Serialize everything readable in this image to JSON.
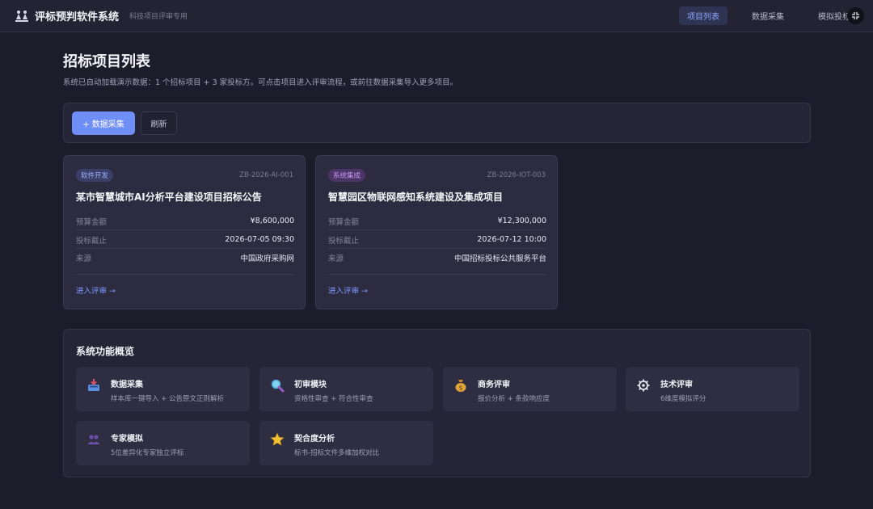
{
  "app": {
    "title": "评标预判软件系统",
    "subtitle": "科技项目评审专用"
  },
  "nav": {
    "items": [
      {
        "label": "项目列表",
        "active": true
      },
      {
        "label": "数据采集",
        "active": false
      },
      {
        "label": "模拟投标",
        "active": false
      }
    ]
  },
  "page": {
    "title": "招标项目列表",
    "description": "系统已自动加载演示数据：1 个招标项目 + 3 家投标方。可点击项目进入评审流程，或前往数据采集导入更多项目。"
  },
  "toolbar": {
    "primary_label": "+ 数据采集",
    "refresh_label": "刷新"
  },
  "projects": [
    {
      "tag": "软件开发",
      "code": "ZB-2026-AI-001",
      "title": "某市智慧城市AI分析平台建设项目招标公告",
      "fields": [
        {
          "key": "预算金额",
          "value": "¥8,600,000"
        },
        {
          "key": "投标截止",
          "value": "2026-07-05 09:30"
        },
        {
          "key": "来源",
          "value": "中国政府采购网"
        }
      ],
      "action": "进入评审 →"
    },
    {
      "tag": "系统集成",
      "code": "ZB-2026-IOT-003",
      "title": "智慧园区物联网感知系统建设及集成项目",
      "fields": [
        {
          "key": "预算金额",
          "value": "¥12,300,000"
        },
        {
          "key": "投标截止",
          "value": "2026-07-12 10:00"
        },
        {
          "key": "来源",
          "value": "中国招标投标公共服务平台"
        }
      ],
      "action": "进入评审 →"
    }
  ],
  "features": {
    "title": "系统功能概览",
    "items": [
      {
        "name": "数据采集",
        "desc": "样本库一键导入 + 公告原文正则解析",
        "icon": "inbox-tray-icon"
      },
      {
        "name": "初审模块",
        "desc": "资格性审查 + 符合性审查",
        "icon": "magnifier-icon"
      },
      {
        "name": "商务评审",
        "desc": "报价分析 + 条款响应度",
        "icon": "money-bag-icon"
      },
      {
        "name": "技术评审",
        "desc": "6维度模拟评分",
        "icon": "gear-icon"
      },
      {
        "name": "专家模拟",
        "desc": "5位差异化专家独立评标",
        "icon": "experts-icon"
      },
      {
        "name": "契合度分析",
        "desc": "标书-招标文件多维加权对比",
        "icon": "star-icon"
      }
    ]
  },
  "colors": {
    "accent": "#6f8ef6",
    "background": "#1d1c2b",
    "card": "#2c2b3f",
    "link": "#7f99ff"
  }
}
